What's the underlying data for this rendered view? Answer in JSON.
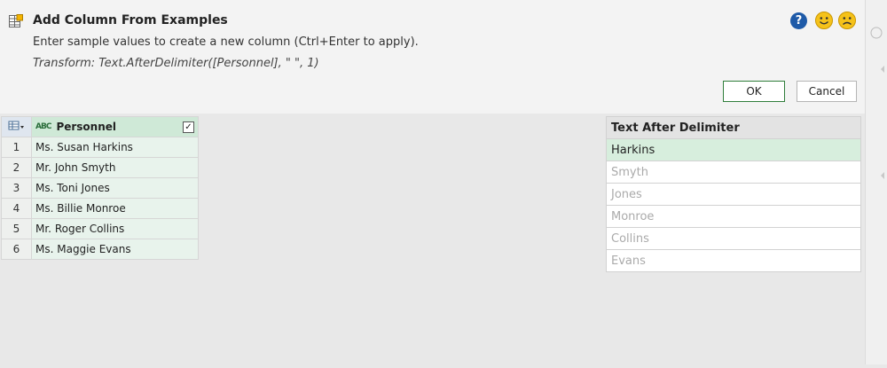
{
  "dialog": {
    "title": "Add Column From Examples",
    "subtitle": "Enter sample values to create a new column (Ctrl+Enter to apply).",
    "transform": "Transform: Text.AfterDelimiter([Personnel], \" \", 1)",
    "help_glyph": "?",
    "ok_label": "OK",
    "cancel_label": "Cancel"
  },
  "source_table": {
    "column_header": "Personnel",
    "type_icon_text": "ABC",
    "rows": [
      {
        "num": "1",
        "value": "Ms. Susan Harkins"
      },
      {
        "num": "2",
        "value": "Mr. John Smyth"
      },
      {
        "num": "3",
        "value": "Ms. Toni Jones"
      },
      {
        "num": "4",
        "value": "Ms. Billie Monroe"
      },
      {
        "num": "5",
        "value": "Mr. Roger Collins"
      },
      {
        "num": "6",
        "value": "Ms. Maggie Evans"
      }
    ]
  },
  "result_table": {
    "column_header": "Text After Delimiter",
    "rows": [
      "Harkins",
      "Smyth",
      "Jones",
      "Monroe",
      "Collins",
      "Evans"
    ]
  },
  "colors": {
    "accent_green": "#d7eedd",
    "help_blue": "#1e5aa8",
    "smiley_yellow": "#f5c21a"
  },
  "icons": [
    "add-column-icon",
    "help-icon",
    "smile-icon",
    "frown-icon",
    "table-menu-icon",
    "abc-type-icon",
    "checkbox-icon"
  ]
}
